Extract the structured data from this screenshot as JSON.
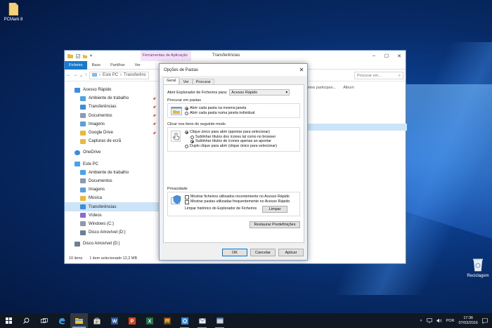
{
  "desktop": {
    "top_icon_label": "PCMark 8",
    "recycle_label": "Reciclagem"
  },
  "explorer": {
    "context_tab": "Ferramentas de Aplicação",
    "window_title": "Transferências",
    "ribbon_tabs": [
      "Ficheiro",
      "Base",
      "Partilhar",
      "Ver"
    ],
    "breadcrumb": [
      "Este PC",
      "Transferênc"
    ],
    "search_placeholder": "Procurar em...",
    "column_headers": [
      "Intérpretes participan...",
      "Álbum"
    ],
    "nav_items": [
      {
        "label": "Acesso Rápido",
        "icon": "star-icon",
        "pinned": false
      },
      {
        "label": "Ambiente de trabalho",
        "icon": "desktop-icon",
        "pinned": true
      },
      {
        "label": "Transferências",
        "icon": "download-icon",
        "pinned": true
      },
      {
        "label": "Documentos",
        "icon": "document-icon",
        "pinned": true
      },
      {
        "label": "Imagens",
        "icon": "image-icon",
        "pinned": true
      },
      {
        "label": "Google Drive",
        "icon": "folder-icon",
        "pinned": true
      },
      {
        "label": "Capturas de ecrã",
        "icon": "folder-icon",
        "pinned": false
      },
      {
        "label": "OneDrive",
        "icon": "cloud-icon",
        "pinned": false
      },
      {
        "label": "Este PC",
        "icon": "computer-icon",
        "pinned": false
      },
      {
        "label": "Ambiente de trabalho",
        "icon": "desktop-icon",
        "pinned": false
      },
      {
        "label": "Documentos",
        "icon": "document-icon",
        "pinned": false
      },
      {
        "label": "Imagens",
        "icon": "image-icon",
        "pinned": false
      },
      {
        "label": "Música",
        "icon": "music-icon",
        "pinned": false
      },
      {
        "label": "Transferências",
        "icon": "download-icon",
        "pinned": false
      },
      {
        "label": "Vídeos",
        "icon": "video-icon",
        "pinned": false
      },
      {
        "label": "Windows (C:)",
        "icon": "drive-icon",
        "pinned": false
      },
      {
        "label": "Disco Amovível (D:)",
        "icon": "removable-drive-icon",
        "pinned": false
      },
      {
        "label": "Disco Amovível (D:)",
        "icon": "removable-drive-icon",
        "pinned": false
      }
    ],
    "status_items": "10 itens",
    "status_selected": "1 item selecionado 12,2 MB"
  },
  "dialog": {
    "title": "Opções de Pastas",
    "tabs": [
      "Geral",
      "Ver",
      "Procurar"
    ],
    "open_label": "Abrir Explorador de Ficheiros para:",
    "open_value": "Acesso Rápido",
    "browse_group": "Procurar em pastas",
    "browse_opt1": "Abrir cada pasta na mesma janela",
    "browse_opt2": "Abrir cada pasta numa janela individual",
    "click_group": "Clicar nos itens do seguinte modo",
    "click_opt1": "Clique único para abrir (apontar para selecionar)",
    "click_sub1": "Sublinhar títulos dos ícones tal como no browser",
    "click_sub2": "Sublinhar títulos de ícones apenas ao apontar",
    "click_opt2": "Duplo clique para abrir (clique único para selecionar)",
    "privacy_group": "Privacidade",
    "privacy_opt1": "Mostrar ficheiros utilizados recentemente no Acesso Rápido",
    "privacy_opt2": "Mostrar pastas utilizadas frequentemente no Acesso Rápido",
    "clear_label": "Limpar histórico do Explorador de Ficheiros",
    "clear_button": "Limpar",
    "restore_button": "Restaurar Predefinições",
    "ok_button": "OK",
    "cancel_button": "Cancelar",
    "apply_button": "Aplicar"
  },
  "taskbar": {
    "apps": [
      "start-icon",
      "search-icon",
      "task-view-icon",
      "edge-icon",
      "file-explorer-icon",
      "store-icon",
      "word-icon",
      "powerpoint-icon",
      "excel-icon",
      "photos-icon",
      "settings-icon",
      "mail-icon",
      "app-icon"
    ],
    "language": "POR",
    "time": "17:36",
    "date": "07/03/2016"
  },
  "colors": {
    "accent": "#1979ca",
    "selection": "#cce4f7",
    "taskbar": "#101823",
    "context_tab": "#f2e3f7"
  }
}
